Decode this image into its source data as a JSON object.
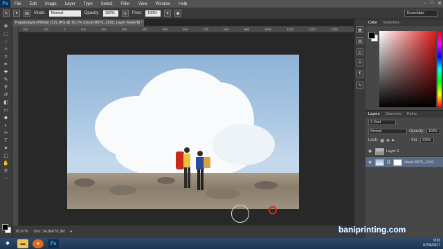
{
  "menu": {
    "app_logo": "Ps",
    "items": [
      "File",
      "Edit",
      "Image",
      "Layer",
      "Type",
      "Select",
      "Filter",
      "View",
      "Window",
      "Help"
    ]
  },
  "options": {
    "mode_label": "Mode:",
    "mode_value": "Normal",
    "opacity_label": "Opacity:",
    "opacity_value": "100%",
    "flow_label": "Flow:",
    "flow_value": "100%",
    "workspace": "Essentials"
  },
  "document": {
    "tab_title": "Papandayan Pilihan (12).JPG @ 16,7% (cloud-8075_1920, Layer Mask/8) *",
    "ruler_ticks": [
      "200",
      "100",
      "0",
      "100",
      "200",
      "300",
      "400",
      "500",
      "600",
      "700",
      "800",
      "900",
      "1000",
      "1100",
      "1200",
      "1300",
      "1400",
      "1500",
      "1600",
      "1700"
    ]
  },
  "status": {
    "zoom": "16,67%",
    "doc_info": "Doc: 34,8M/78,3M"
  },
  "color_panel": {
    "tabs": [
      "Color",
      "Swatches"
    ]
  },
  "layers_panel": {
    "tabs": [
      "Layers",
      "Channels",
      "Paths"
    ],
    "filter_label": "Kind",
    "blend_mode": "Normal",
    "opacity_label": "Opacity:",
    "opacity_value": "100%",
    "lock_label": "Lock:",
    "fill_label": "Fill:",
    "fill_value": "100%",
    "layers": [
      {
        "name": "Layer 0"
      },
      {
        "name": "cloud-8075_1920"
      }
    ]
  },
  "taskbar": {
    "time": "9:33",
    "date": "07/05/2017"
  },
  "watermark": "baniprinting.com",
  "colors": {
    "accent": "#596b85",
    "brush_cursor_red": "#e0221d"
  }
}
